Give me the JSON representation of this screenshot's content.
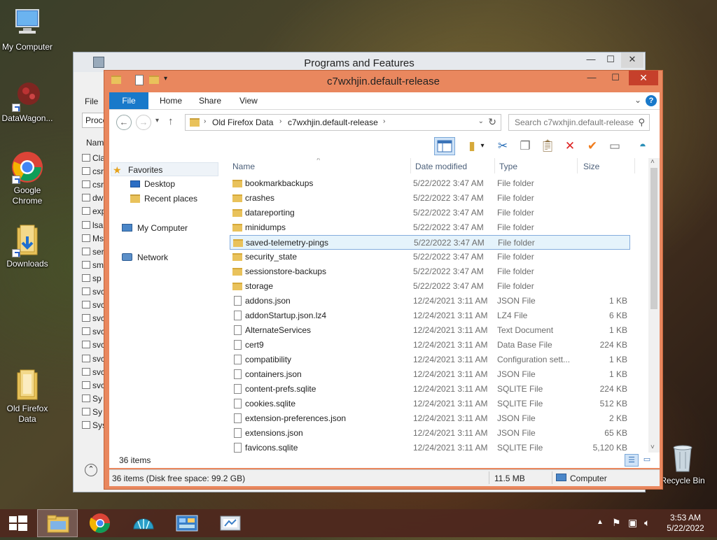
{
  "desktop": {
    "icons": [
      {
        "label": "My Computer"
      },
      {
        "label": "DataWagon..."
      },
      {
        "label": "Google Chrome"
      },
      {
        "label": "Downloads"
      },
      {
        "label": "Old Firefox Data"
      },
      {
        "label": "Recycle Bin"
      }
    ]
  },
  "programs_window": {
    "title": "Programs and Features",
    "side_items": [
      "File",
      "Proce",
      "Nam"
    ],
    "list_items": [
      "Cla",
      "csr",
      "csr",
      "dw",
      "exp",
      "lsa",
      "Ms",
      "ser",
      "sm",
      "sp",
      "svc",
      "svc",
      "svc",
      "svc",
      "svc",
      "svc",
      "svc",
      "svc",
      "Sy",
      "Sy",
      "Sys"
    ]
  },
  "explorer": {
    "title": "c7wxhjin.default-release",
    "ribbon_tabs": [
      "File",
      "Home",
      "Share",
      "View"
    ],
    "breadcrumb": [
      "Old Firefox Data",
      "c7wxhjin.default-release"
    ],
    "search_placeholder": "Search c7wxhjin.default-release",
    "nav": {
      "favorites": "Favorites",
      "desktop": "Desktop",
      "recent": "Recent places",
      "computer": "My Computer",
      "network": "Network"
    },
    "columns": {
      "name": "Name",
      "date": "Date modified",
      "type": "Type",
      "size": "Size"
    },
    "files": [
      {
        "name": "bookmarkbackups",
        "date": "5/22/2022 3:47 AM",
        "type": "File folder",
        "size": "",
        "kind": "folder"
      },
      {
        "name": "crashes",
        "date": "5/22/2022 3:47 AM",
        "type": "File folder",
        "size": "",
        "kind": "folder"
      },
      {
        "name": "datareporting",
        "date": "5/22/2022 3:47 AM",
        "type": "File folder",
        "size": "",
        "kind": "folder"
      },
      {
        "name": "minidumps",
        "date": "5/22/2022 3:47 AM",
        "type": "File folder",
        "size": "",
        "kind": "folder"
      },
      {
        "name": "saved-telemetry-pings",
        "date": "5/22/2022 3:47 AM",
        "type": "File folder",
        "size": "",
        "kind": "folder",
        "selected": true
      },
      {
        "name": "security_state",
        "date": "5/22/2022 3:47 AM",
        "type": "File folder",
        "size": "",
        "kind": "folder"
      },
      {
        "name": "sessionstore-backups",
        "date": "5/22/2022 3:47 AM",
        "type": "File folder",
        "size": "",
        "kind": "folder"
      },
      {
        "name": "storage",
        "date": "5/22/2022 3:47 AM",
        "type": "File folder",
        "size": "",
        "kind": "folder"
      },
      {
        "name": "addons.json",
        "date": "12/24/2021 3:11 AM",
        "type": "JSON File",
        "size": "1 KB",
        "kind": "file"
      },
      {
        "name": "addonStartup.json.lz4",
        "date": "12/24/2021 3:11 AM",
        "type": "LZ4 File",
        "size": "6 KB",
        "kind": "file"
      },
      {
        "name": "AlternateServices",
        "date": "12/24/2021 3:11 AM",
        "type": "Text Document",
        "size": "1 KB",
        "kind": "file"
      },
      {
        "name": "cert9",
        "date": "12/24/2021 3:11 AM",
        "type": "Data Base File",
        "size": "224 KB",
        "kind": "file"
      },
      {
        "name": "compatibility",
        "date": "12/24/2021 3:11 AM",
        "type": "Configuration sett...",
        "size": "1 KB",
        "kind": "file"
      },
      {
        "name": "containers.json",
        "date": "12/24/2021 3:11 AM",
        "type": "JSON File",
        "size": "1 KB",
        "kind": "file"
      },
      {
        "name": "content-prefs.sqlite",
        "date": "12/24/2021 3:11 AM",
        "type": "SQLITE File",
        "size": "224 KB",
        "kind": "file"
      },
      {
        "name": "cookies.sqlite",
        "date": "12/24/2021 3:11 AM",
        "type": "SQLITE File",
        "size": "512 KB",
        "kind": "file"
      },
      {
        "name": "extension-preferences.json",
        "date": "12/24/2021 3:11 AM",
        "type": "JSON File",
        "size": "2 KB",
        "kind": "file"
      },
      {
        "name": "extensions.json",
        "date": "12/24/2021 3:11 AM",
        "type": "JSON File",
        "size": "65 KB",
        "kind": "file"
      },
      {
        "name": "favicons.sqlite",
        "date": "12/24/2021 3:11 AM",
        "type": "SQLITE File",
        "size": "5,120 KB",
        "kind": "file"
      }
    ],
    "item_count": "36 items",
    "status_free": "36 items (Disk free space: 99.2 GB)",
    "status_size": "11.5 MB",
    "status_location": "Computer"
  },
  "clock": {
    "time": "3:53 AM",
    "date": "5/22/2022"
  }
}
